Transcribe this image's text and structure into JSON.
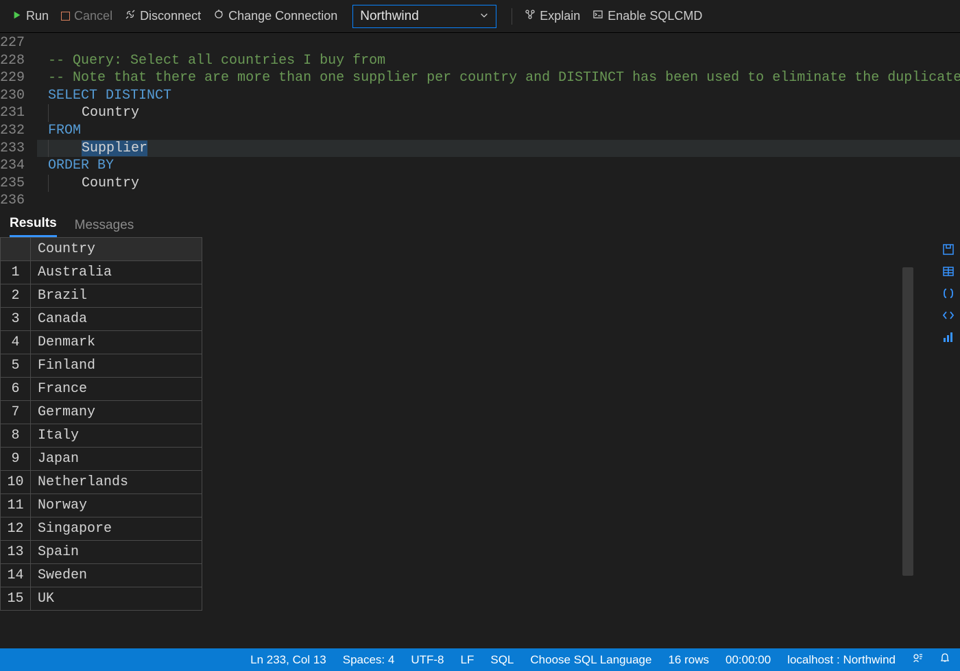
{
  "toolbar": {
    "run_label": "Run",
    "cancel_label": "Cancel",
    "disconnect_label": "Disconnect",
    "change_conn_label": "Change Connection",
    "db_selected": "Northwind",
    "explain_label": "Explain",
    "enable_sqlcmd_label": "Enable SQLCMD"
  },
  "editor": {
    "lines": [
      {
        "num": 227,
        "tokens": []
      },
      {
        "num": 228,
        "tokens": [
          {
            "t": "-- Query: Select all countries I buy from",
            "c": "tk-comment"
          }
        ]
      },
      {
        "num": 229,
        "tokens": [
          {
            "t": "-- Note that there are more than one supplier per country and DISTINCT has been used to eliminate the duplicates.",
            "c": "tk-comment"
          }
        ]
      },
      {
        "num": 230,
        "tokens": [
          {
            "t": "SELECT",
            "c": "tk-keyword"
          },
          {
            "t": " "
          },
          {
            "t": "DISTINCT",
            "c": "tk-keyword"
          }
        ]
      },
      {
        "num": 231,
        "indent": true,
        "tokens": [
          {
            "t": "Country",
            "c": "tk-ident"
          }
        ]
      },
      {
        "num": 232,
        "tokens": [
          {
            "t": "FROM",
            "c": "tk-keyword"
          }
        ]
      },
      {
        "num": 233,
        "indent": true,
        "cursor": true,
        "tokens": [
          {
            "t": "Supplier",
            "c": "tk-ident",
            "sel": true
          }
        ]
      },
      {
        "num": 234,
        "tokens": [
          {
            "t": "ORDER",
            "c": "tk-keyword"
          },
          {
            "t": " "
          },
          {
            "t": "BY",
            "c": "tk-keyword"
          }
        ]
      },
      {
        "num": 235,
        "indent": true,
        "tokens": [
          {
            "t": "Country",
            "c": "tk-ident"
          }
        ]
      },
      {
        "num": 236,
        "tokens": []
      }
    ]
  },
  "results": {
    "tab_results": "Results",
    "tab_messages": "Messages",
    "columns": [
      "Country"
    ],
    "rows": [
      [
        "Australia"
      ],
      [
        "Brazil"
      ],
      [
        "Canada"
      ],
      [
        "Denmark"
      ],
      [
        "Finland"
      ],
      [
        "France"
      ],
      [
        "Germany"
      ],
      [
        "Italy"
      ],
      [
        "Japan"
      ],
      [
        "Netherlands"
      ],
      [
        "Norway"
      ],
      [
        "Singapore"
      ],
      [
        "Spain"
      ],
      [
        "Sweden"
      ],
      [
        "UK"
      ]
    ]
  },
  "statusbar": {
    "ln_col": "Ln 233, Col 13",
    "spaces": "Spaces: 4",
    "encoding": "UTF-8",
    "eol": "LF",
    "lang": "SQL",
    "lang_action": "Choose SQL Language",
    "rows": "16 rows",
    "time": "00:00:00",
    "conn": "localhost : Northwind"
  }
}
